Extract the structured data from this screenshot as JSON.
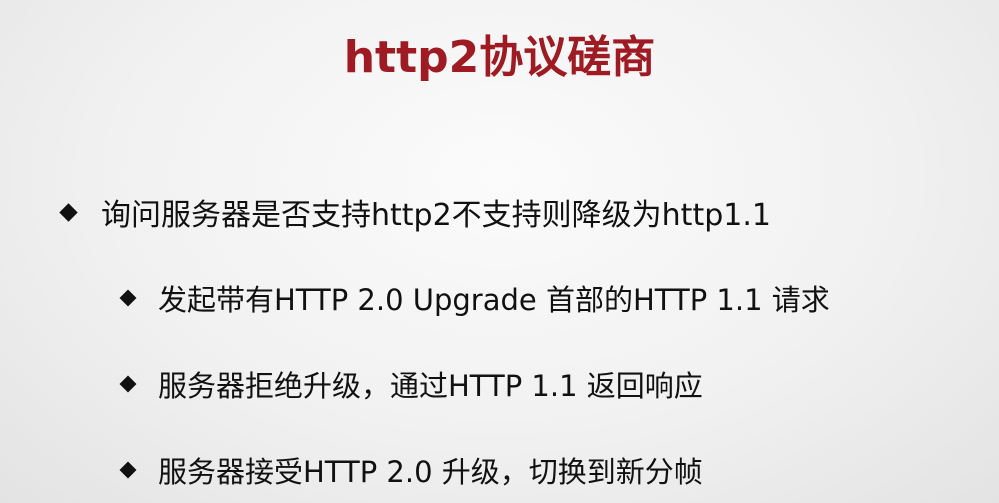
{
  "slide": {
    "title": "http2协议磋商",
    "bullets": [
      {
        "level": 1,
        "text": "询问服务器是否支持http2不支持则降级为http1.1",
        "icon": "diamond-bullet-icon"
      },
      {
        "level": 2,
        "text": "发起带有HTTP 2.0 Upgrade 首部的HTTP 1.1 请求",
        "icon": "diamond-bullet-icon"
      },
      {
        "level": 2,
        "text": "服务器拒绝升级，通过HTTP 1.1 返回响应",
        "icon": "diamond-bullet-icon"
      },
      {
        "level": 2,
        "text": "服务器接受HTTP 2.0 升级，切换到新分帧",
        "icon": "diamond-bullet-icon"
      }
    ],
    "colors": {
      "title": "#9e1b24",
      "text": "#111111",
      "background": "#f1f1f1"
    }
  }
}
